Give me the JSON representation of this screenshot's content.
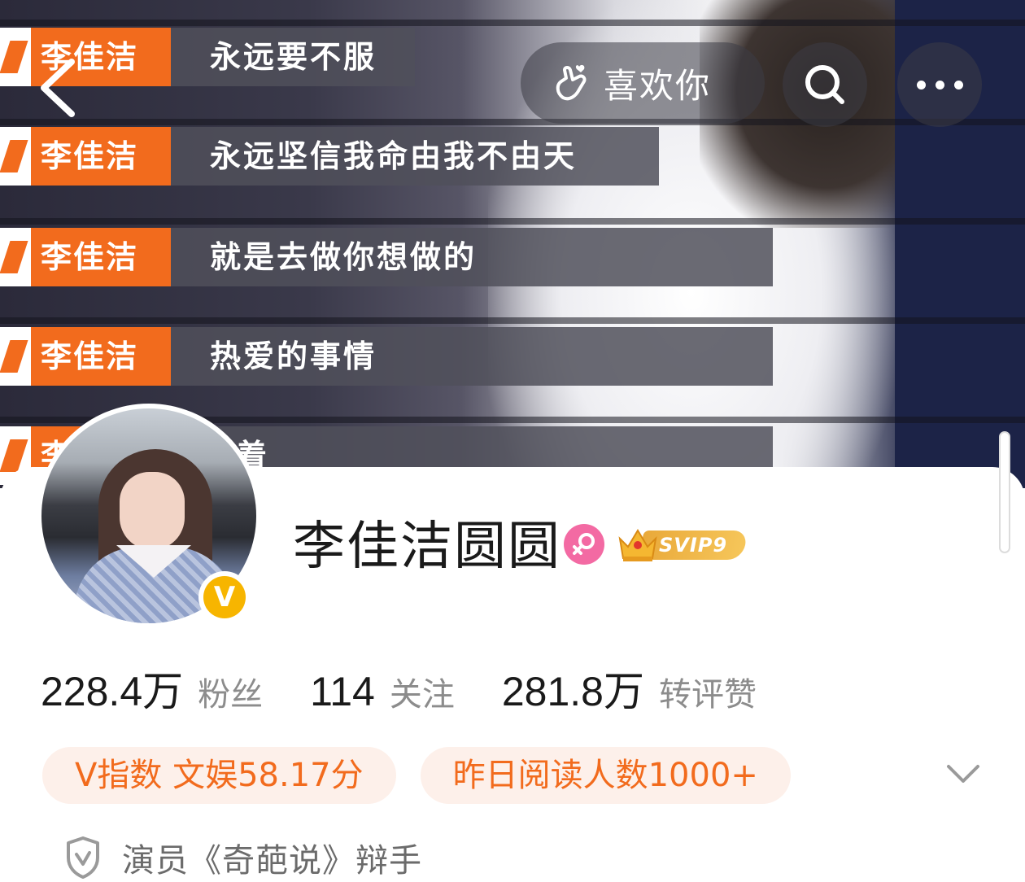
{
  "banner": {
    "captions": [
      {
        "tag": "李佳洁",
        "text": "永远要不服"
      },
      {
        "tag": "李佳洁",
        "text": "永远坚信我命由我不由天"
      },
      {
        "tag": "李佳洁",
        "text": "就是去做你想做的"
      },
      {
        "tag": "李佳洁",
        "text": "热爱的事情"
      },
      {
        "tag": "李",
        "text": "着"
      }
    ]
  },
  "topbar": {
    "like_label": "喜欢你",
    "icons": [
      "back-arrow-icon",
      "hand-heart-icon",
      "search-icon",
      "more-icon"
    ]
  },
  "profile": {
    "username": "李佳洁圆圆",
    "verified_badge": "V",
    "gender": "female",
    "svip_label": "SVIP9",
    "accent_color": "#f26b1d"
  },
  "stats": [
    {
      "value": "228.4万",
      "label": "粉丝"
    },
    {
      "value": "114",
      "label": "关注"
    },
    {
      "value": "281.8万",
      "label": "转评赞"
    }
  ],
  "tags": [
    {
      "label": "V指数 文娱58.17分"
    },
    {
      "label": "昨日阅读人数1000+"
    }
  ],
  "description": "演员《奇葩说》辩手"
}
